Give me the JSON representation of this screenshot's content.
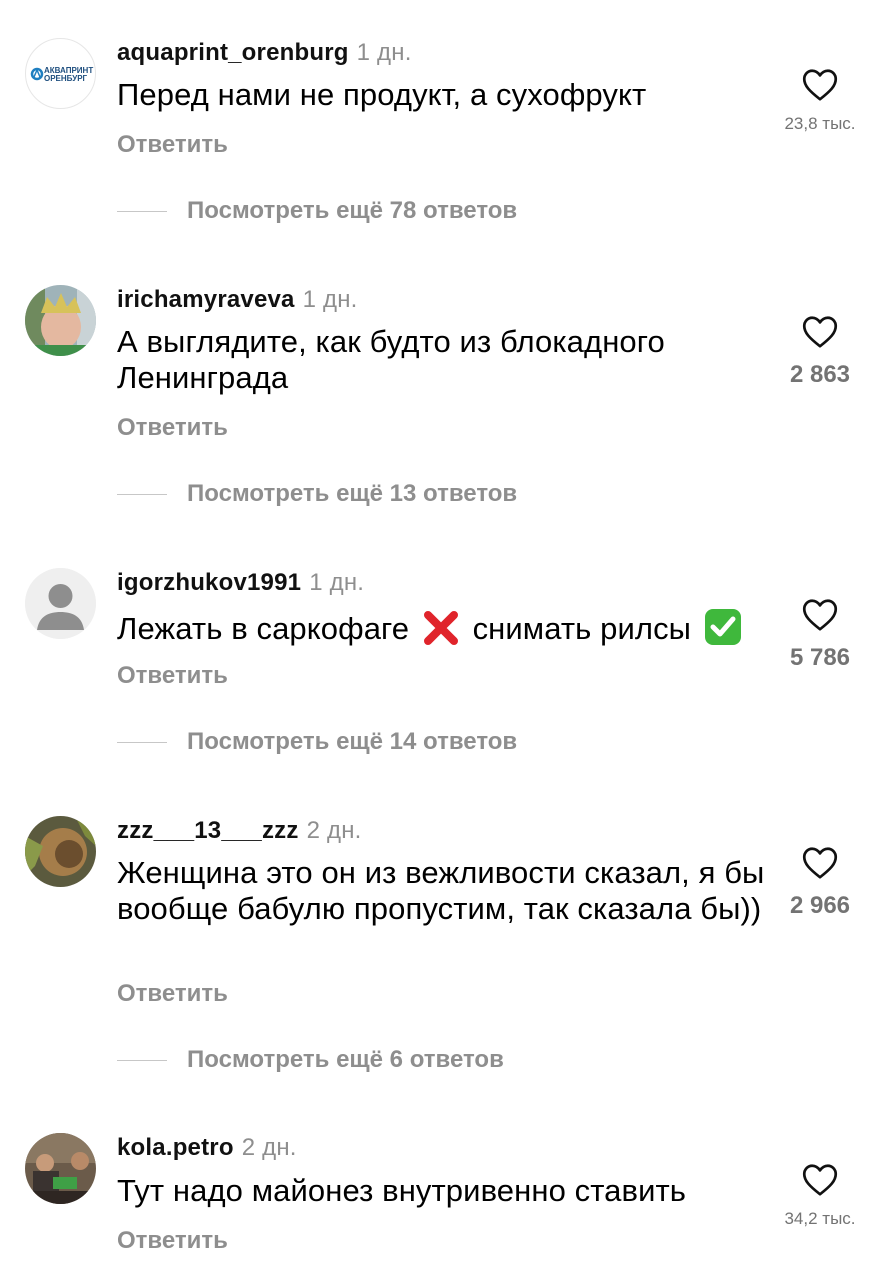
{
  "comments": [
    {
      "username": "aquaprint_orenburg",
      "time": "1 дн.",
      "text": "Перед нами не продукт, а сухофрукт",
      "reply_label": "Ответить",
      "likes": "23,8 тыс.",
      "view_more": "Посмотреть ещё 78 ответов",
      "avatar_logo_line1": "АКВАПРИНТ",
      "avatar_logo_line2": "ОРЕНБУРГ"
    },
    {
      "username": "irichamyraveva",
      "time": "1 дн.",
      "text": "А выглядите, как будто из блокадного Ленинграда",
      "reply_label": "Ответить",
      "likes": "2 863",
      "view_more": "Посмотреть ещё 13 ответов"
    },
    {
      "username": "igorzhukov1991",
      "time": "1 дн.",
      "text_part1": "Лежать в саркофаге",
      "text_part2": "снимать рилсы",
      "reply_label": "Ответить",
      "likes": "5 786",
      "view_more": "Посмотреть ещё 14 ответов"
    },
    {
      "username": "zzz___13___zzz",
      "time": "2 дн.",
      "text": "Женщина это он из вежливости сказал, я бы вообще бабулю пропустим, так сказала бы))",
      "reply_label": "Ответить",
      "likes": "2 966",
      "view_more": "Посмотреть ещё 6 ответов"
    },
    {
      "username": "kola.petro",
      "time": "2 дн.",
      "text": "Тут надо майонез внутривенно ставить",
      "reply_label": "Ответить",
      "likes": "34,2 тыс."
    }
  ],
  "colors": {
    "secondary_text": "#8e8e8e",
    "primary_text": "#000000",
    "like_count": "#737373",
    "logo_blue": "#1f7fc1"
  },
  "icons": [
    "heart-icon",
    "cross-mark-emoji",
    "check-mark-emoji",
    "default-avatar-icon"
  ]
}
